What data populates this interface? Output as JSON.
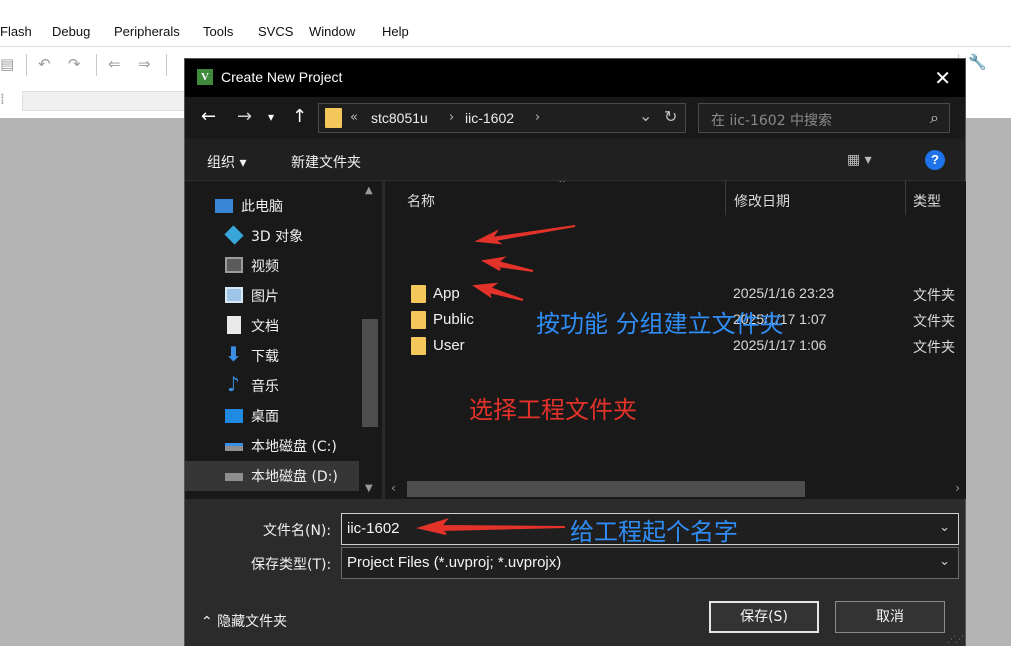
{
  "menu": {
    "items": [
      "Flash",
      "Debug",
      "Peripherals",
      "Tools",
      "SVCS",
      "Window",
      "Help"
    ]
  },
  "dialog": {
    "title": "Create New Project",
    "close_glyph": "✕",
    "address": {
      "overflow": "«",
      "segments": [
        "stc8051u",
        "iic-1602"
      ],
      "separator": "›",
      "dropdown": "⌄",
      "refresh": "↻"
    },
    "search_placeholder": "在 iic-1602 中搜索",
    "commands": {
      "organize": "组织 ▾",
      "new_folder": "新建文件夹",
      "view": "▦ ▾",
      "help": "?"
    },
    "nav_items": [
      {
        "label": "此电脑",
        "icon": "computer-icon"
      },
      {
        "label": "3D 对象",
        "icon": "cube-icon"
      },
      {
        "label": "视频",
        "icon": "video-icon"
      },
      {
        "label": "图片",
        "icon": "picture-icon"
      },
      {
        "label": "文档",
        "icon": "document-icon"
      },
      {
        "label": "下载",
        "icon": "download-icon"
      },
      {
        "label": "音乐",
        "icon": "music-icon"
      },
      {
        "label": "桌面",
        "icon": "desktop-icon"
      },
      {
        "label": "本地磁盘 (C:)",
        "icon": "drive-icon"
      },
      {
        "label": "本地磁盘 (D:)",
        "icon": "drive-icon"
      }
    ],
    "columns": {
      "name": "名称",
      "modified": "修改日期",
      "type": "类型"
    },
    "files": [
      {
        "name": "App",
        "modified": "2025/1/16 23:23",
        "type": "文件夹"
      },
      {
        "name": "Public",
        "modified": "2025/1/17 1:07",
        "type": "文件夹"
      },
      {
        "name": "User",
        "modified": "2025/1/17 1:06",
        "type": "文件夹"
      }
    ],
    "filename_label": "文件名(N):",
    "filename_value": "iic-1602",
    "filetype_label": "保存类型(T):",
    "filetype_value": "Project Files (*.uvproj; *.uvprojx)",
    "hide_folders": "⌃ 隐藏文件夹",
    "save_button": "保存(S)",
    "cancel_button": "取消"
  },
  "annotations": {
    "group_folders": "按功能 分组建立文件夹",
    "choose_folder": "选择工程文件夹",
    "name_project": "给工程起个名字",
    "blue": "#2f8df5",
    "red": "#e2322a"
  }
}
